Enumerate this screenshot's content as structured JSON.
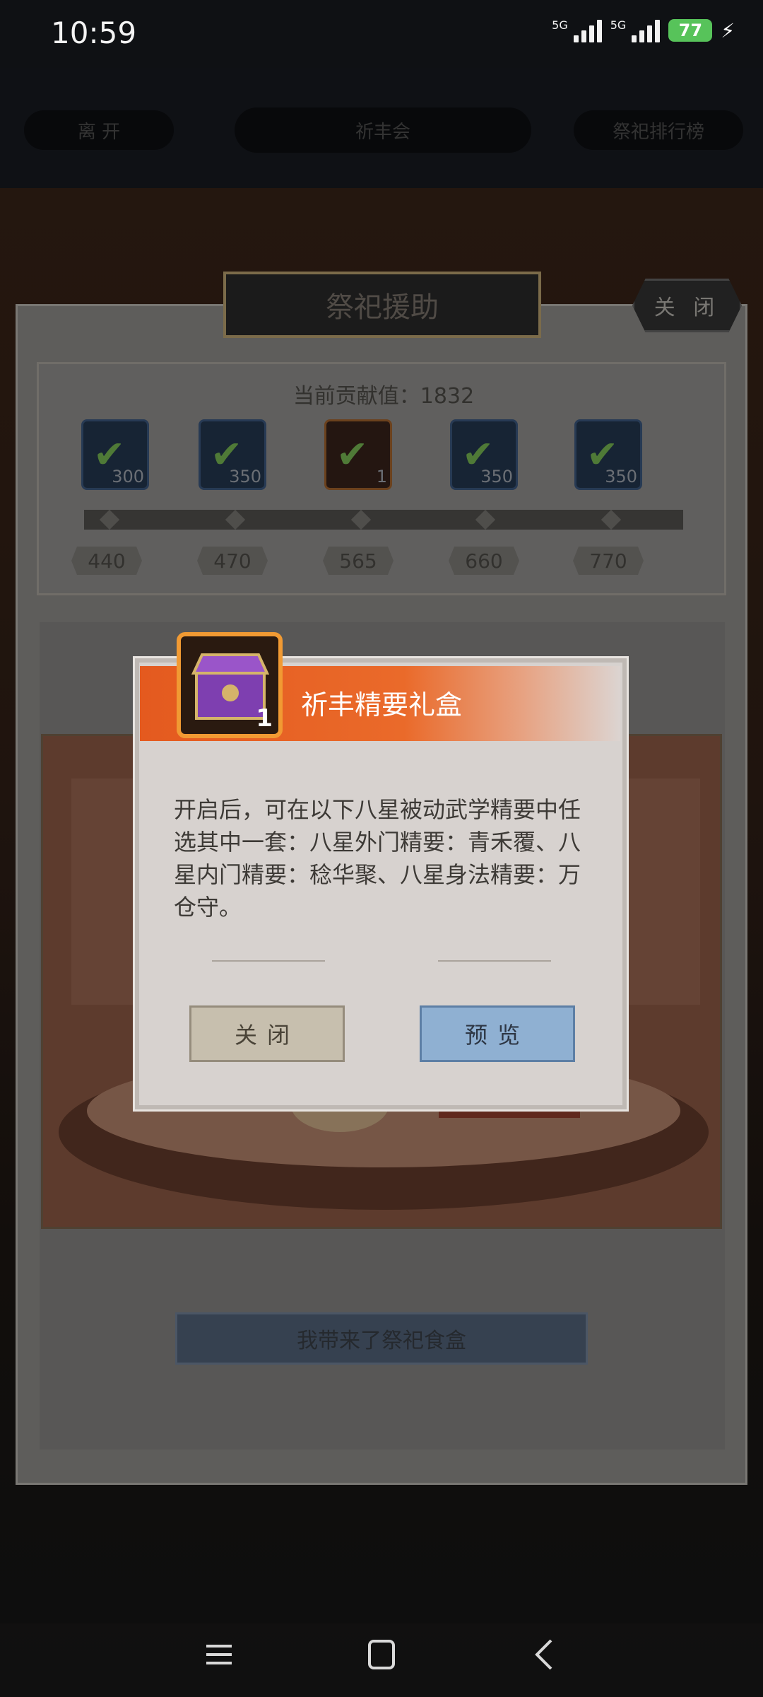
{
  "status_bar": {
    "time": "10:59",
    "sim1_label": "5G",
    "sim2_label": "5G",
    "battery_percent": "77"
  },
  "header": {
    "left_pill": "离 开",
    "center_pill": "祈丰会",
    "right_pill": "祭祀排行榜",
    "title": "祭祀援助",
    "close_label": "关 闭"
  },
  "contribution": {
    "label": "当前贡献值：1832",
    "rewards": [
      {
        "count": "300",
        "claimed": true
      },
      {
        "count": "350",
        "claimed": true
      },
      {
        "count": "1",
        "claimed": true
      },
      {
        "count": "350",
        "claimed": true
      },
      {
        "count": "350",
        "claimed": true
      }
    ],
    "milestones": [
      "440",
      "470",
      "565",
      "660",
      "770"
    ]
  },
  "bring_button": "我带来了祭祀食盒",
  "dialog": {
    "title": "祈丰精要礼盒",
    "item_count": "1",
    "description": "开启后，可在以下八星被动武学精要中任选其中一套：八星外门精要：青禾覆、八星内门精要：稔华聚、八星身法精要：万仓守。",
    "close_button": "关闭",
    "preview_button": "预览"
  },
  "colors": {
    "accent_orange": "#e45a1f",
    "preview_blue": "#8fb0d2",
    "battery_green": "#57c35a"
  }
}
